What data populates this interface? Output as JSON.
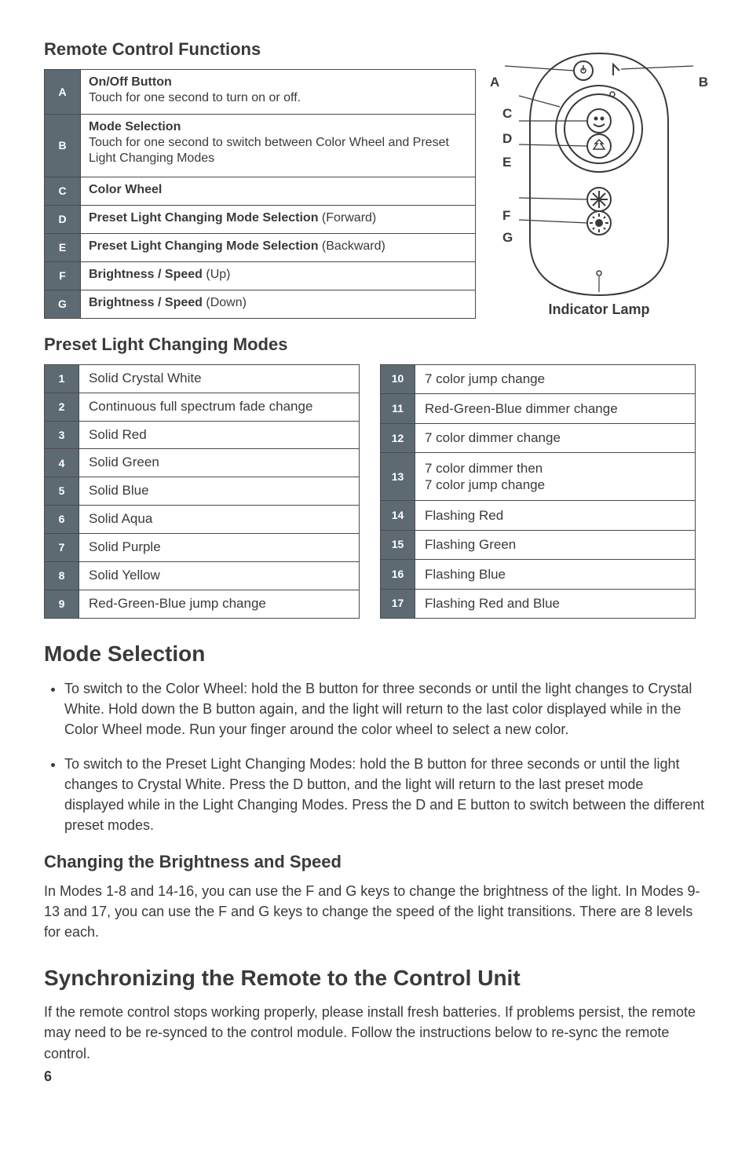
{
  "headings": {
    "remote_functions": "Remote Control Functions",
    "preset_modes": "Preset Light Changing Modes",
    "mode_selection": "Mode Selection",
    "changing_brightness": "Changing the Brightness and Speed",
    "synchronizing": "Synchronizing the Remote to the Control Unit"
  },
  "functions": [
    {
      "key": "A",
      "title": "On/Off Button",
      "text": "Touch for one second to turn on or off."
    },
    {
      "key": "B",
      "title": "Mode Selection",
      "text": "Touch for one second to switch between Color Wheel and Preset Light Changing Modes"
    },
    {
      "key": "C",
      "title": "Color Wheel",
      "text": ""
    },
    {
      "key": "D",
      "title": "Preset Light Changing Mode Selection",
      "text_after": " (Forward)"
    },
    {
      "key": "E",
      "title": "Preset Light Changing Mode Selection",
      "text_after": " (Backward)"
    },
    {
      "key": "F",
      "title": "Brightness / Speed",
      "text_after": " (Up)"
    },
    {
      "key": "G",
      "title": "Brightness / Speed",
      "text_after": " (Down)"
    }
  ],
  "diagram": {
    "labels": {
      "A": "A",
      "B": "B",
      "C": "C",
      "D": "D",
      "E": "E",
      "F": "F",
      "G": "G"
    },
    "indicator": "Indicator Lamp"
  },
  "modes_left": [
    {
      "key": "1",
      "text": "Solid Crystal White"
    },
    {
      "key": "2",
      "text": "Continuous full spectrum fade change"
    },
    {
      "key": "3",
      "text": "Solid Red"
    },
    {
      "key": "4",
      "text": "Solid Green"
    },
    {
      "key": "5",
      "text": "Solid Blue"
    },
    {
      "key": "6",
      "text": "Solid Aqua"
    },
    {
      "key": "7",
      "text": "Solid Purple"
    },
    {
      "key": "8",
      "text": "Solid Yellow"
    },
    {
      "key": "9",
      "text": "Red-Green-Blue jump change"
    }
  ],
  "modes_right": [
    {
      "key": "10",
      "text": "7 color jump change"
    },
    {
      "key": "11",
      "text": "Red-Green-Blue dimmer change"
    },
    {
      "key": "12",
      "text": "7 color dimmer change"
    },
    {
      "key": "13",
      "text": "7 color dimmer then\n7 color jump change"
    },
    {
      "key": "14",
      "text": "Flashing Red"
    },
    {
      "key": "15",
      "text": "Flashing Green"
    },
    {
      "key": "16",
      "text": "Flashing Blue"
    },
    {
      "key": "17",
      "text": "Flashing Red and Blue"
    }
  ],
  "body": {
    "bullet1": "To switch to the Color Wheel: hold the B button for three seconds or until the light changes to Crystal White. Hold down the B button again, and the light will return to the last color displayed while in the Color Wheel mode. Run your finger around the color wheel to select a new color.",
    "bullet2": "To switch to the Preset Light Changing Modes: hold the B button for three seconds or until the light changes to Crystal White. Press the D button, and the light will return to the last preset mode displayed while in the Light Changing Modes. Press the D and E button to switch between the different preset modes.",
    "changing": "In Modes 1-8 and 14-16, you can use the F and G keys to change the brightness of the light. In Modes 9-13 and 17, you can use the F and G keys to change the speed of the light transitions. There are 8 levels for each.",
    "sync": "If the remote control stops working properly, please install fresh batteries. If problems persist, the remote may need to be re-synced to the control module. Follow the instructions below to re-sync the remote control."
  },
  "page_number": "6"
}
